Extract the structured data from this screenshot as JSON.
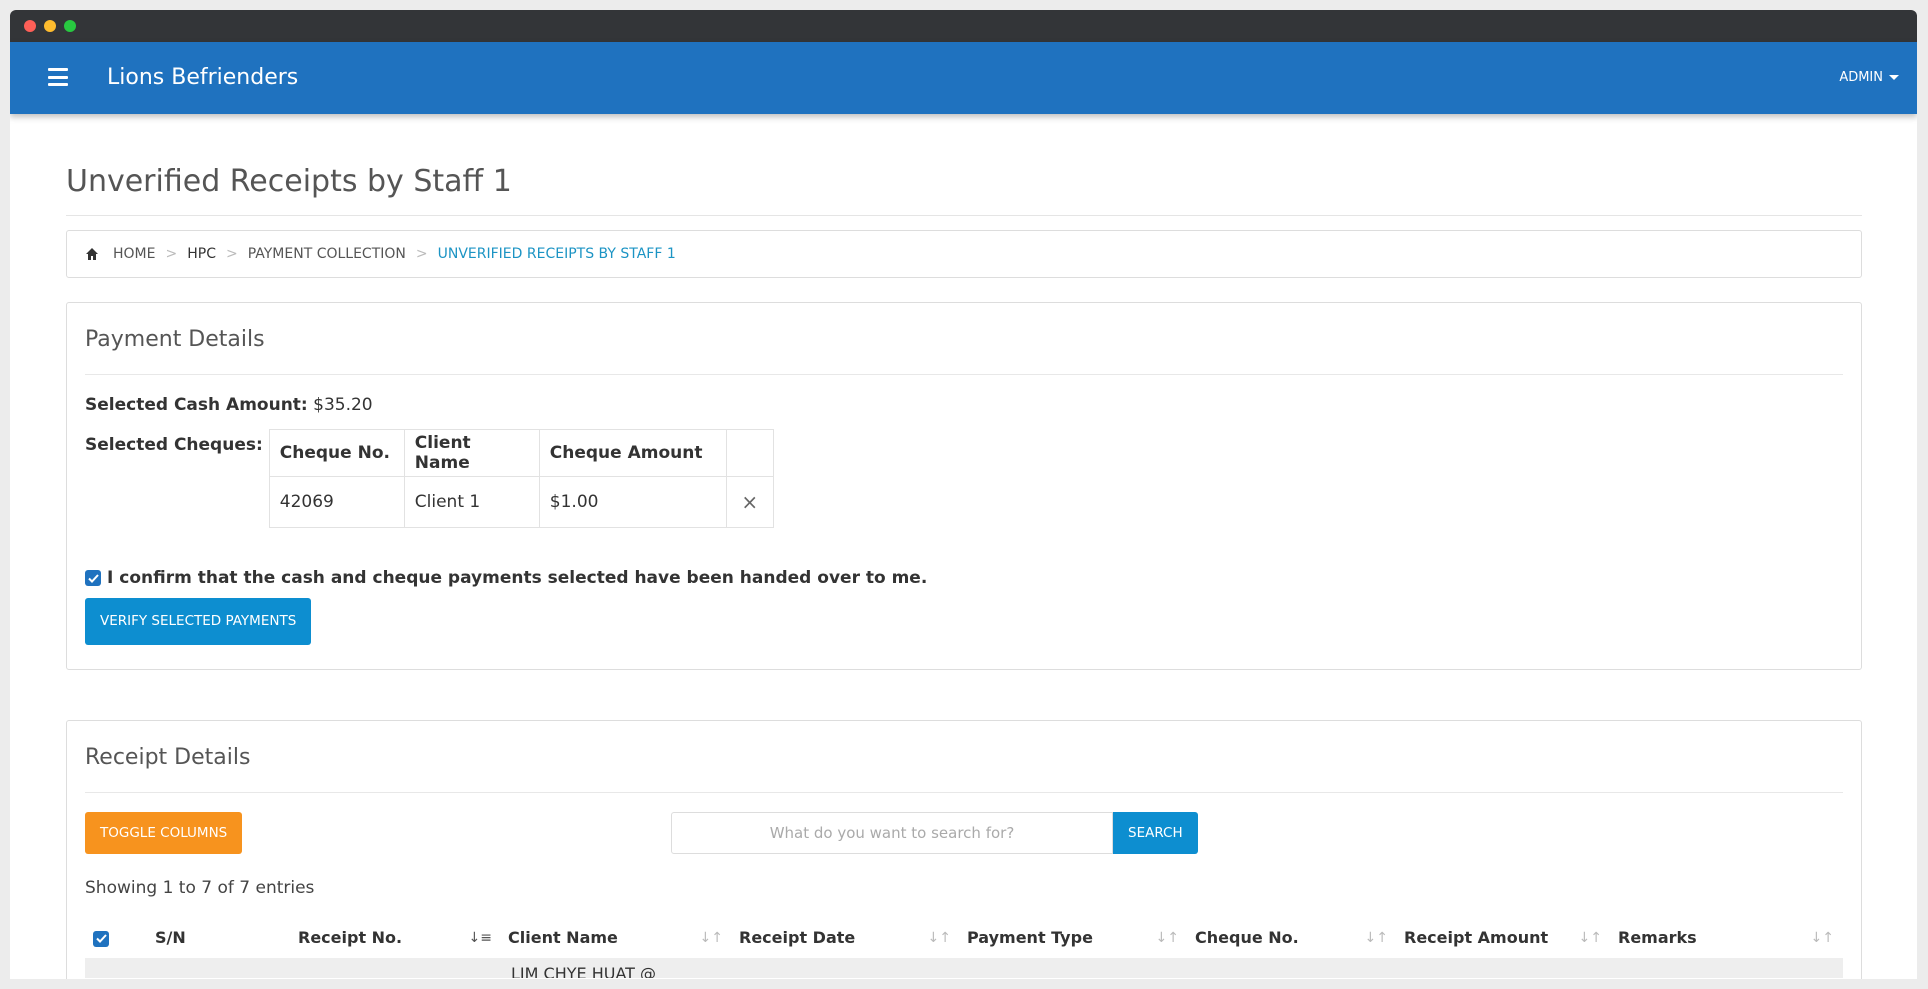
{
  "navbar": {
    "brand": "Lions Befrienders",
    "user": "ADMIN"
  },
  "page": {
    "title": "Unverified Receipts by Staff 1"
  },
  "breadcrumb": [
    "HOME",
    "HPC",
    "PAYMENT COLLECTION",
    "UNVERIFIED RECEIPTS BY STAFF 1"
  ],
  "payment_details": {
    "heading": "Payment Details",
    "cash_label": "Selected Cash Amount:",
    "cash_value": "$35.20",
    "cheques_label": "Selected Cheques:",
    "cheque_columns": [
      "Cheque No.",
      "Client Name",
      "Cheque Amount"
    ],
    "cheques": [
      {
        "no": "42069",
        "client": "Client 1",
        "amount": "$1.00"
      }
    ],
    "remove_glyph": "×",
    "confirm_text": "I confirm that the cash and cheque payments selected have been handed over to me.",
    "confirm_checked": true,
    "verify_button": "VERIFY SELECTED PAYMENTS"
  },
  "receipt_details": {
    "heading": "Receipt Details",
    "toggle_button": "TOGGLE COLUMNS",
    "search_placeholder": "What do you want to search for?",
    "search_button": "SEARCH",
    "showing": "Showing 1 to 7 of 7 entries",
    "columns": [
      "S/N",
      "Receipt No.",
      "Client Name",
      "Receipt Date",
      "Payment Type",
      "Cheque No.",
      "Receipt Amount",
      "Remarks"
    ],
    "first_row_partial": "LIM CHYE HUAT @"
  },
  "colors": {
    "navbar": "#1f72bf",
    "primary_button": "#0d8ed0",
    "toggle_button": "#f7931e",
    "active_crumb": "#1c94c4"
  },
  "icons": [
    "hamburger-icon",
    "home-icon",
    "close-icon",
    "checkbox-checked-icon",
    "sort-icon",
    "sort-desc-icon",
    "caret-down-icon"
  ]
}
